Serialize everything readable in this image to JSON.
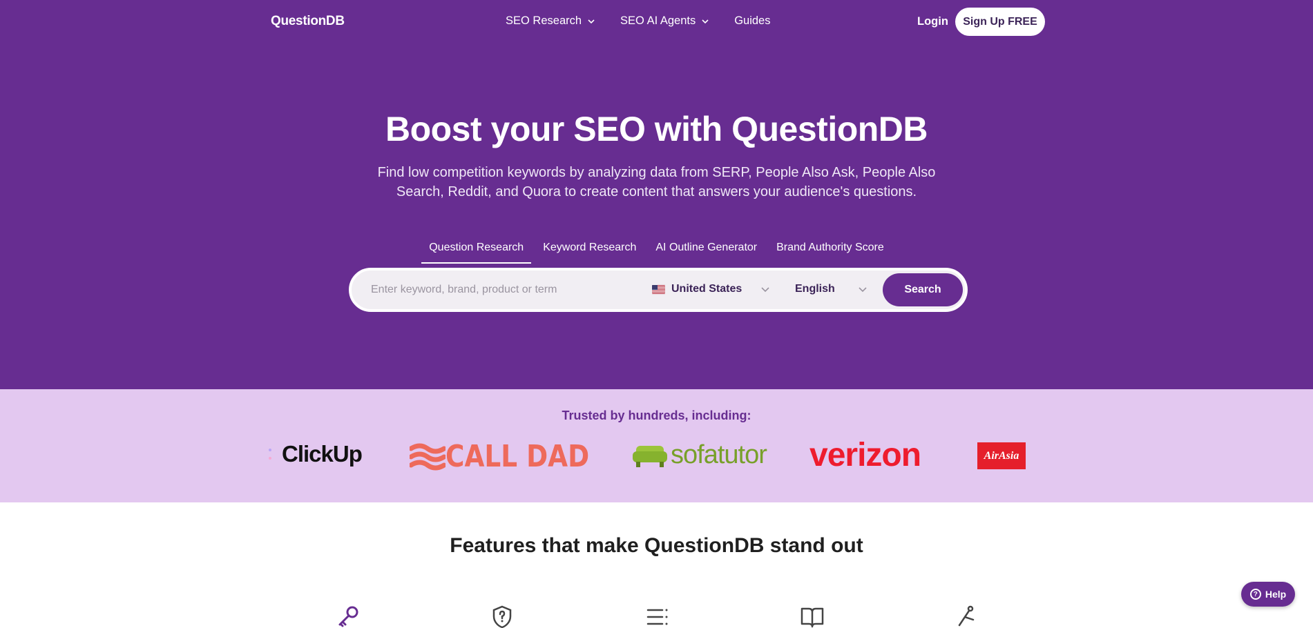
{
  "brand": {
    "name": "QuestionDB"
  },
  "nav": {
    "links": [
      {
        "label": "SEO Research",
        "dropdown": true
      },
      {
        "label": "SEO AI Agents",
        "dropdown": true
      },
      {
        "label": "Guides",
        "dropdown": false
      }
    ],
    "login": "Login",
    "signup": "Sign Up FREE"
  },
  "hero": {
    "title": "Boost your SEO with QuestionDB",
    "subtitle": "Find low competition keywords by analyzing data from SERP, People Also Ask, People Also Search, Reddit, and Quora to create content that answers your audience's questions.",
    "tabs": [
      {
        "label": "Question Research",
        "active": true
      },
      {
        "label": "Keyword Research",
        "active": false
      },
      {
        "label": "AI Outline Generator",
        "active": false
      },
      {
        "label": "Brand Authority Score",
        "active": false
      }
    ],
    "search": {
      "placeholder": "Enter keyword, brand, product or term",
      "value": "",
      "country": "United States",
      "language": "English",
      "button": "Search"
    }
  },
  "trusted": {
    "title": "Trusted by hundreds, including:",
    "logos": [
      "ClickUp",
      "CALL DAD",
      "sofatutor",
      "verizon",
      "AirAsia"
    ]
  },
  "features": {
    "title": "Features that make QuestionDB stand out",
    "icons": [
      "key-icon",
      "shield-question-icon",
      "list-icon",
      "book-open-icon",
      "network-icon"
    ]
  },
  "help": {
    "label": "Help"
  },
  "colors": {
    "brand_purple": "#672d91",
    "trusted_bg": "#e3c8f0",
    "calldad": "#ee6a5b",
    "verizon": "#ee1c2e",
    "sofatutor": "#78a02a",
    "airasia": "#e51f2b"
  }
}
